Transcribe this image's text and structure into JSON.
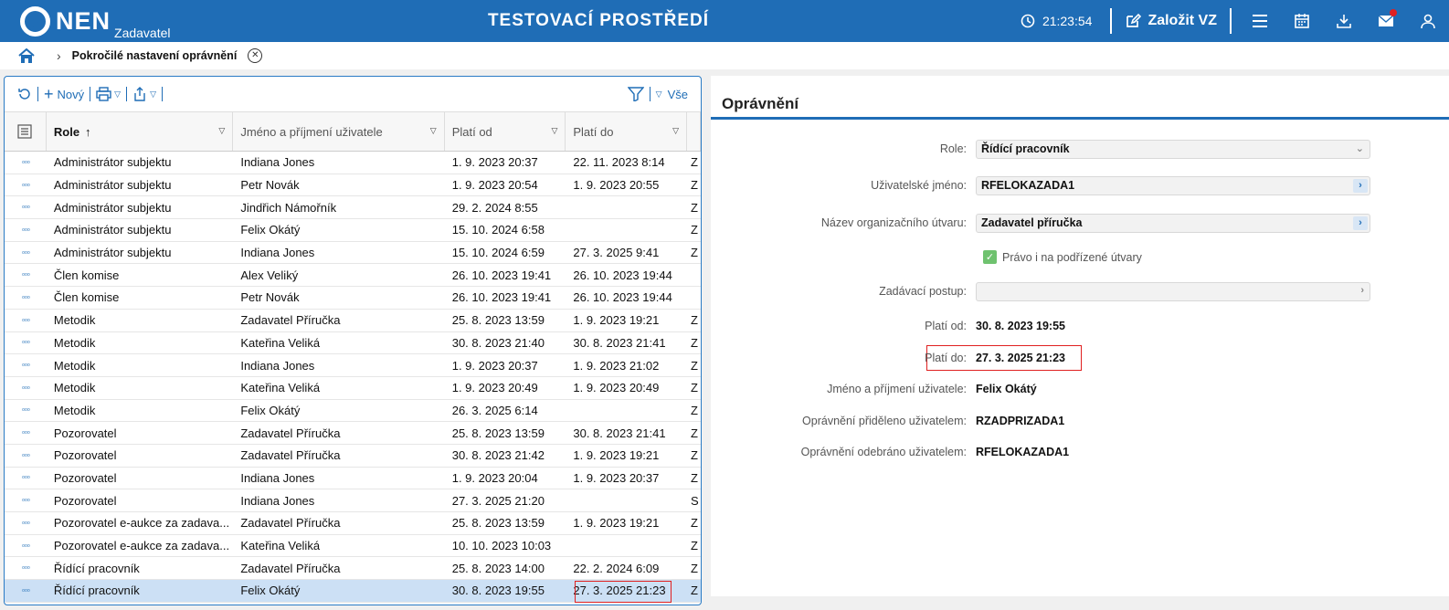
{
  "header": {
    "logo_text": "NEN",
    "logo_sub": "Zadavatel",
    "env_title": "TESTOVACÍ PROSTŘEDÍ",
    "clock": "21:23:54",
    "create_label": "Založit VZ",
    "icons": [
      "clock-icon",
      "edit-icon",
      "menu-icon",
      "calendar-icon",
      "download-icon",
      "mail-icon",
      "user-icon"
    ],
    "accent_color": "#1f6db6",
    "notification_color": "#e02020"
  },
  "breadcrumb": {
    "current": "Pokročilé nastavení oprávnění"
  },
  "toolbar": {
    "new_label": "Nový",
    "filter_label": "Vše"
  },
  "table": {
    "columns": [
      "Role",
      "Jméno a příjmení uživatele",
      "Platí od",
      "Platí do"
    ],
    "rows": [
      {
        "role": "Administrátor subjektu",
        "name": "Indiana Jones",
        "from": "1. 9. 2023 20:37",
        "to": "22. 11. 2023 8:14",
        "extra": "Z"
      },
      {
        "role": "Administrátor subjektu",
        "name": "Petr Novák",
        "from": "1. 9. 2023 20:54",
        "to": "1. 9. 2023 20:55",
        "extra": "Z"
      },
      {
        "role": "Administrátor subjektu",
        "name": "Jindřich Námořník",
        "from": "29. 2. 2024 8:55",
        "to": "",
        "extra": "Z"
      },
      {
        "role": "Administrátor subjektu",
        "name": "Felix Okátý",
        "from": "15. 10. 2024 6:58",
        "to": "",
        "extra": "Z"
      },
      {
        "role": "Administrátor subjektu",
        "name": "Indiana Jones",
        "from": "15. 10. 2024 6:59",
        "to": "27. 3. 2025 9:41",
        "extra": "Z"
      },
      {
        "role": "Člen komise",
        "name": "Alex Veliký",
        "from": "26. 10. 2023 19:41",
        "to": "26. 10. 2023 19:44",
        "extra": ""
      },
      {
        "role": "Člen komise",
        "name": "Petr Novák",
        "from": "26. 10. 2023 19:41",
        "to": "26. 10. 2023 19:44",
        "extra": ""
      },
      {
        "role": "Metodik",
        "name": "Zadavatel Příručka",
        "from": "25. 8. 2023 13:59",
        "to": "1. 9. 2023 19:21",
        "extra": "Z"
      },
      {
        "role": "Metodik",
        "name": "Kateřina Veliká",
        "from": "30. 8. 2023 21:40",
        "to": "30. 8. 2023 21:41",
        "extra": "Z"
      },
      {
        "role": "Metodik",
        "name": "Indiana Jones",
        "from": "1. 9. 2023 20:37",
        "to": "1. 9. 2023 21:02",
        "extra": "Z"
      },
      {
        "role": "Metodik",
        "name": "Kateřina Veliká",
        "from": "1. 9. 2023 20:49",
        "to": "1. 9. 2023 20:49",
        "extra": "Z"
      },
      {
        "role": "Metodik",
        "name": "Felix Okátý",
        "from": "26. 3. 2025 6:14",
        "to": "",
        "extra": "Z"
      },
      {
        "role": "Pozorovatel",
        "name": "Zadavatel Příručka",
        "from": "25. 8. 2023 13:59",
        "to": "30. 8. 2023 21:41",
        "extra": "Z"
      },
      {
        "role": "Pozorovatel",
        "name": "Zadavatel Příručka",
        "from": "30. 8. 2023 21:42",
        "to": "1. 9. 2023 19:21",
        "extra": "Z"
      },
      {
        "role": "Pozorovatel",
        "name": "Indiana Jones",
        "from": "1. 9. 2023 20:04",
        "to": "1. 9. 2023 20:37",
        "extra": "Z"
      },
      {
        "role": "Pozorovatel",
        "name": "Indiana Jones",
        "from": "27. 3. 2025 21:20",
        "to": "",
        "extra": "S"
      },
      {
        "role": "Pozorovatel e-aukce za zadava...",
        "name": "Zadavatel Příručka",
        "from": "25. 8. 2023 13:59",
        "to": "1. 9. 2023 19:21",
        "extra": "Z"
      },
      {
        "role": "Pozorovatel e-aukce za zadava...",
        "name": "Kateřina Veliká",
        "from": "10. 10. 2023 10:03",
        "to": "",
        "extra": "Z"
      },
      {
        "role": "Řídící pracovník",
        "name": "Zadavatel Příručka",
        "from": "25. 8. 2023 14:00",
        "to": "22. 2. 2024 6:09",
        "extra": "Z"
      },
      {
        "role": "Řídící pracovník",
        "name": "Felix Okátý",
        "from": "30. 8. 2023 19:55",
        "to": "27. 3. 2025 21:23",
        "extra": "Z"
      }
    ],
    "selected_row_index": 19,
    "selected_color": "#cce0f5"
  },
  "detail": {
    "title": "Oprávnění",
    "role_label": "Role:",
    "role_value": "Řídící pracovník",
    "username_label": "Uživatelské jméno:",
    "username_value": "RFELOKAZADA1",
    "unit_label": "Název organizačního útvaru:",
    "unit_value": "Zadavatel příručka",
    "subunits_label": "Právo i na podřízené útvary",
    "subunits_checked": true,
    "procedure_label": "Zadávací postup:",
    "procedure_value": "",
    "from_label": "Platí od:",
    "from_value": "30. 8. 2023 19:55",
    "to_label": "Platí do:",
    "to_value": "27. 3. 2025 21:23",
    "fullname_label": "Jméno a příjmení uživatele:",
    "fullname_value": "Felix Okátý",
    "granted_label": "Oprávnění přiděleno uživatelem:",
    "granted_value": "RZADPRIZADA1",
    "revoked_label": "Oprávnění odebráno uživatelem:",
    "revoked_value": "RFELOKAZADA1",
    "highlight_color": "#e02020"
  }
}
